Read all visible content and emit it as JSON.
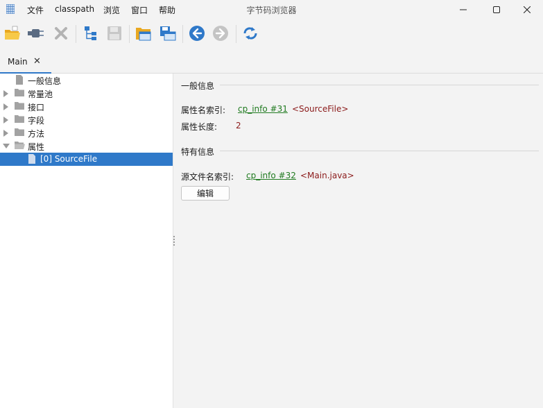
{
  "window": {
    "title": "字节码浏览器",
    "controls": [
      "minimize-icon",
      "maximize-icon",
      "close-icon"
    ]
  },
  "menu": [
    "文件",
    "classpath",
    "浏览",
    "窗口",
    "帮助"
  ],
  "toolbar": {
    "buttons": [
      "open-folder-icon",
      "plug-icon",
      "close-x-icon",
      "class-hierarchy-icon",
      "save-disk-icon",
      "folder-window-icon",
      "save-window-icon",
      "back-arrow-icon",
      "forward-arrow-icon",
      "refresh-icon"
    ],
    "disabled": [
      "close-x-icon",
      "save-disk-icon",
      "forward-arrow-icon"
    ]
  },
  "tabs": [
    {
      "label": "Main",
      "active": true
    }
  ],
  "tree": [
    {
      "label": "一般信息",
      "level": 1,
      "expandable": false,
      "icon": "file-icon"
    },
    {
      "label": "常量池",
      "level": 0,
      "expandable": true,
      "expanded": false,
      "icon": "folder-icon"
    },
    {
      "label": "接口",
      "level": 0,
      "expandable": true,
      "expanded": false,
      "icon": "folder-icon"
    },
    {
      "label": "字段",
      "level": 0,
      "expandable": true,
      "expanded": false,
      "icon": "folder-icon"
    },
    {
      "label": "方法",
      "level": 0,
      "expandable": true,
      "expanded": false,
      "icon": "folder-icon"
    },
    {
      "label": "属性",
      "level": 0,
      "expandable": true,
      "expanded": true,
      "icon": "folder-open-icon"
    },
    {
      "label": "[0] SourceFile",
      "level": 2,
      "expandable": false,
      "selected": true,
      "icon": "file-icon"
    }
  ],
  "detail": {
    "general": {
      "title": "一般信息",
      "name_index_label": "属性名索引:",
      "name_index_link": "cp_info #31",
      "name_index_ref": "<SourceFile>",
      "length_label": "属性长度:",
      "length_value": "2"
    },
    "specific": {
      "title": "特有信息",
      "source_index_label": "源文件名索引:",
      "source_index_link": "cp_info #32",
      "source_index_ref": "<Main.java>",
      "edit_button": "编辑"
    }
  },
  "colors": {
    "accent": "#2f79c9",
    "link": "#1f7a1f",
    "reference": "#8b1a1a",
    "panel_bg": "#f3f3f3"
  }
}
